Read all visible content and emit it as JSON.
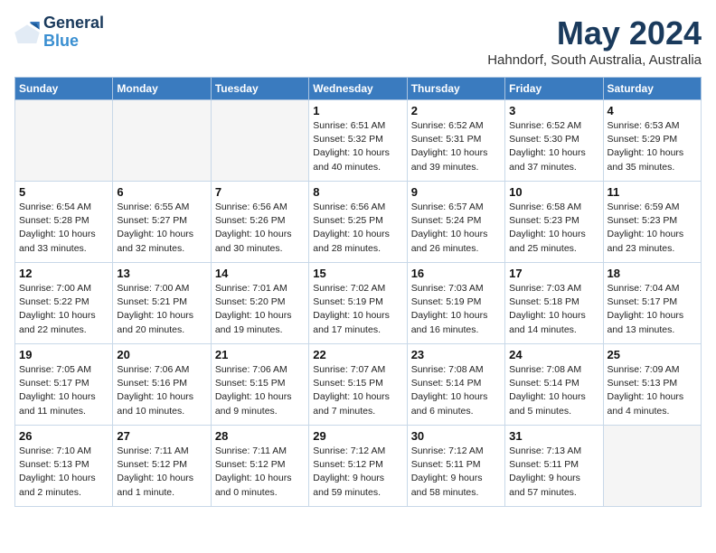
{
  "header": {
    "logo_line1": "General",
    "logo_line2": "Blue",
    "month": "May 2024",
    "location": "Hahndorf, South Australia, Australia"
  },
  "weekdays": [
    "Sunday",
    "Monday",
    "Tuesday",
    "Wednesday",
    "Thursday",
    "Friday",
    "Saturday"
  ],
  "weeks": [
    [
      {
        "day": "",
        "info": ""
      },
      {
        "day": "",
        "info": ""
      },
      {
        "day": "",
        "info": ""
      },
      {
        "day": "1",
        "info": "Sunrise: 6:51 AM\nSunset: 5:32 PM\nDaylight: 10 hours\nand 40 minutes."
      },
      {
        "day": "2",
        "info": "Sunrise: 6:52 AM\nSunset: 5:31 PM\nDaylight: 10 hours\nand 39 minutes."
      },
      {
        "day": "3",
        "info": "Sunrise: 6:52 AM\nSunset: 5:30 PM\nDaylight: 10 hours\nand 37 minutes."
      },
      {
        "day": "4",
        "info": "Sunrise: 6:53 AM\nSunset: 5:29 PM\nDaylight: 10 hours\nand 35 minutes."
      }
    ],
    [
      {
        "day": "5",
        "info": "Sunrise: 6:54 AM\nSunset: 5:28 PM\nDaylight: 10 hours\nand 33 minutes."
      },
      {
        "day": "6",
        "info": "Sunrise: 6:55 AM\nSunset: 5:27 PM\nDaylight: 10 hours\nand 32 minutes."
      },
      {
        "day": "7",
        "info": "Sunrise: 6:56 AM\nSunset: 5:26 PM\nDaylight: 10 hours\nand 30 minutes."
      },
      {
        "day": "8",
        "info": "Sunrise: 6:56 AM\nSunset: 5:25 PM\nDaylight: 10 hours\nand 28 minutes."
      },
      {
        "day": "9",
        "info": "Sunrise: 6:57 AM\nSunset: 5:24 PM\nDaylight: 10 hours\nand 26 minutes."
      },
      {
        "day": "10",
        "info": "Sunrise: 6:58 AM\nSunset: 5:23 PM\nDaylight: 10 hours\nand 25 minutes."
      },
      {
        "day": "11",
        "info": "Sunrise: 6:59 AM\nSunset: 5:23 PM\nDaylight: 10 hours\nand 23 minutes."
      }
    ],
    [
      {
        "day": "12",
        "info": "Sunrise: 7:00 AM\nSunset: 5:22 PM\nDaylight: 10 hours\nand 22 minutes."
      },
      {
        "day": "13",
        "info": "Sunrise: 7:00 AM\nSunset: 5:21 PM\nDaylight: 10 hours\nand 20 minutes."
      },
      {
        "day": "14",
        "info": "Sunrise: 7:01 AM\nSunset: 5:20 PM\nDaylight: 10 hours\nand 19 minutes."
      },
      {
        "day": "15",
        "info": "Sunrise: 7:02 AM\nSunset: 5:19 PM\nDaylight: 10 hours\nand 17 minutes."
      },
      {
        "day": "16",
        "info": "Sunrise: 7:03 AM\nSunset: 5:19 PM\nDaylight: 10 hours\nand 16 minutes."
      },
      {
        "day": "17",
        "info": "Sunrise: 7:03 AM\nSunset: 5:18 PM\nDaylight: 10 hours\nand 14 minutes."
      },
      {
        "day": "18",
        "info": "Sunrise: 7:04 AM\nSunset: 5:17 PM\nDaylight: 10 hours\nand 13 minutes."
      }
    ],
    [
      {
        "day": "19",
        "info": "Sunrise: 7:05 AM\nSunset: 5:17 PM\nDaylight: 10 hours\nand 11 minutes."
      },
      {
        "day": "20",
        "info": "Sunrise: 7:06 AM\nSunset: 5:16 PM\nDaylight: 10 hours\nand 10 minutes."
      },
      {
        "day": "21",
        "info": "Sunrise: 7:06 AM\nSunset: 5:15 PM\nDaylight: 10 hours\nand 9 minutes."
      },
      {
        "day": "22",
        "info": "Sunrise: 7:07 AM\nSunset: 5:15 PM\nDaylight: 10 hours\nand 7 minutes."
      },
      {
        "day": "23",
        "info": "Sunrise: 7:08 AM\nSunset: 5:14 PM\nDaylight: 10 hours\nand 6 minutes."
      },
      {
        "day": "24",
        "info": "Sunrise: 7:08 AM\nSunset: 5:14 PM\nDaylight: 10 hours\nand 5 minutes."
      },
      {
        "day": "25",
        "info": "Sunrise: 7:09 AM\nSunset: 5:13 PM\nDaylight: 10 hours\nand 4 minutes."
      }
    ],
    [
      {
        "day": "26",
        "info": "Sunrise: 7:10 AM\nSunset: 5:13 PM\nDaylight: 10 hours\nand 2 minutes."
      },
      {
        "day": "27",
        "info": "Sunrise: 7:11 AM\nSunset: 5:12 PM\nDaylight: 10 hours\nand 1 minute."
      },
      {
        "day": "28",
        "info": "Sunrise: 7:11 AM\nSunset: 5:12 PM\nDaylight: 10 hours\nand 0 minutes."
      },
      {
        "day": "29",
        "info": "Sunrise: 7:12 AM\nSunset: 5:12 PM\nDaylight: 9 hours\nand 59 minutes."
      },
      {
        "day": "30",
        "info": "Sunrise: 7:12 AM\nSunset: 5:11 PM\nDaylight: 9 hours\nand 58 minutes."
      },
      {
        "day": "31",
        "info": "Sunrise: 7:13 AM\nSunset: 5:11 PM\nDaylight: 9 hours\nand 57 minutes."
      },
      {
        "day": "",
        "info": ""
      }
    ]
  ]
}
